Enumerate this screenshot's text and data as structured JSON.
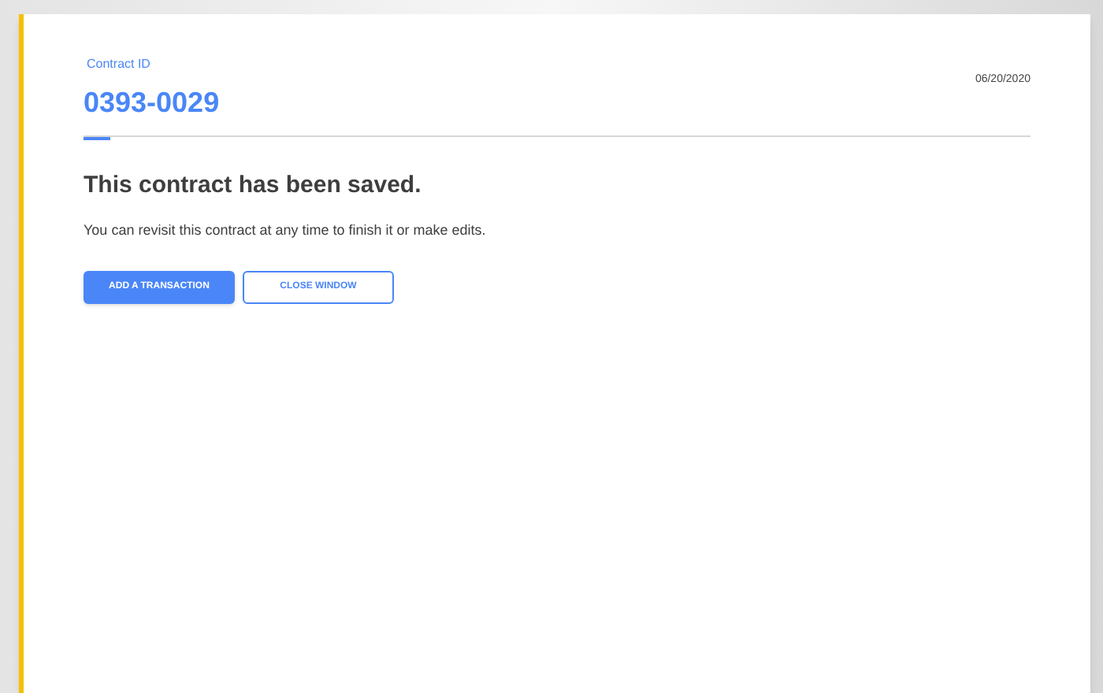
{
  "contract": {
    "label": "Contract ID",
    "id": "0393-0029",
    "date": "06/20/2020"
  },
  "message": {
    "title": "This contract has been saved.",
    "body": "You can revisit this contract at any time to finish it or make edits."
  },
  "buttons": [
    {
      "label": "ADD A TRANSACTION",
      "kind": "primary"
    },
    {
      "label": "CLOSE WINDOW",
      "kind": "secondary"
    }
  ]
}
